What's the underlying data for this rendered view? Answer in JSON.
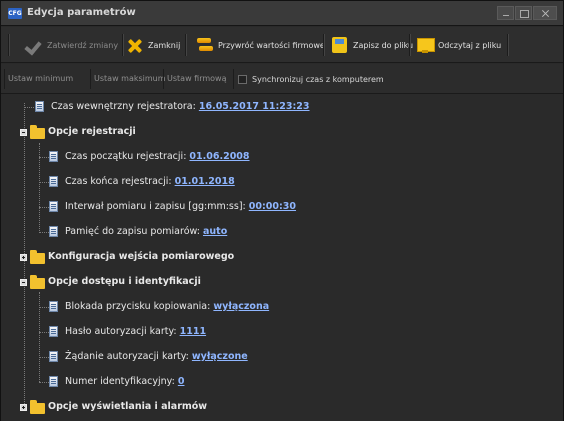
{
  "window": {
    "title": "Edycja parametrów",
    "app_icon_text": "CFG"
  },
  "toolbar": {
    "confirm_label": "Zatwierdź zmiany",
    "close_label": "Zamknij",
    "restore_label": "Przywróć wartości firmowe",
    "save_label": "Zapisz do pliku",
    "load_label": "Odczytaj z pliku"
  },
  "toolbar2": {
    "min_label": "Ustaw minimum",
    "max_label": "Ustaw maksimum",
    "factory_label": "Ustaw firmową",
    "sync_label": "Synchronizuj czas z komputerem"
  },
  "tree": {
    "internal_time_label": "Czas wewnętrzny rejestratora: ",
    "internal_time_value": "16.05.2017 11:23:23",
    "registration_group": "Opcje rejestracji",
    "reg_start_label": "Czas początku rejestracji: ",
    "reg_start_value": "01.06.2008",
    "reg_end_label": "Czas końca rejestracji: ",
    "reg_end_value": "01.01.2018",
    "interval_label": "Interwał pomiaru i zapisu [gg:mm:ss]: ",
    "interval_value": "00:00:30",
    "memory_label": "Pamięć do zapisu pomiarów: ",
    "memory_value": "auto",
    "input_config_group": "Konfiguracja wejścia pomiarowego",
    "access_group": "Opcje dostępu i identyfikacji",
    "copy_lock_label": "Blokada przycisku kopiowania: ",
    "copy_lock_value": "wyłączona",
    "password_label": "Hasło autoryzacji karty: ",
    "password_value": "1111",
    "auth_request_label": "Żądanie autoryzacji karty: ",
    "auth_request_value": "wyłączone",
    "id_label": "Numer identyfikacyjny: ",
    "id_value": "0",
    "display_group": "Opcje wyświetlania i alarmów"
  }
}
